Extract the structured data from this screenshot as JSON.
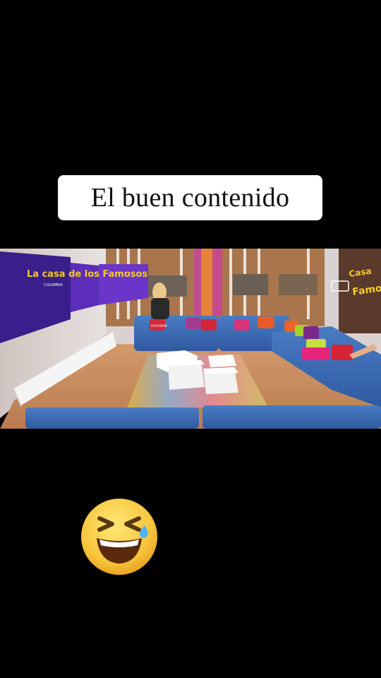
{
  "caption": {
    "text": "El buen contenido"
  },
  "scene": {
    "description_icon": "tv-set-living-room-image",
    "show_logo_text": "La casa de los Famosos",
    "show_logo_sub": "COLOMBIA",
    "pillow_label": "POSTOBÓN"
  },
  "emoji": {
    "icon": "laughing-with-tear-emoji"
  },
  "colors": {
    "background": "#000000",
    "caption_bg": "#ffffff",
    "sofa_blue": "#3d6db5",
    "floor_wood": "#c88f62"
  }
}
